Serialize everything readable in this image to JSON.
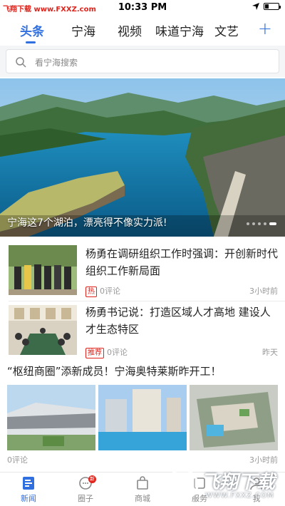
{
  "status_bar": {
    "left_text": "飞翔下载 www.FXXZ.com",
    "time": "10:33 PM"
  },
  "tabs": [
    "头条",
    "宁海",
    "视频",
    "味道宁海",
    "文艺"
  ],
  "add_label": "+",
  "search": {
    "placeholder": "看宁海搜索"
  },
  "banner": {
    "caption": "宁海这7个湖泊，漂亮得不像实力派!"
  },
  "news": [
    {
      "title": "杨勇在调研组织工作时强调：开创新时代组织工作新局面",
      "tag": "热",
      "comments": "0评论",
      "time": "3小时前"
    },
    {
      "title": "杨勇书记说：打造区域人才高地 建设人才生态特区",
      "tag": "推荐",
      "comments": "0评论",
      "time": "昨天"
    },
    {
      "title": "“枢纽商圈”添新成员！宁海奥特莱斯昨开工！",
      "comments": "0评论",
      "time": "3小时前"
    }
  ],
  "bottom_nav": [
    {
      "label": "新闻"
    },
    {
      "label": "圈子",
      "badge": "新"
    },
    {
      "label": "商城"
    },
    {
      "label": "服务"
    },
    {
      "label": "我"
    }
  ],
  "watermark": {
    "text": "飞翔下载",
    "url": "WWW.FXXZ.COM"
  },
  "colors": {
    "accent": "#2f6fe0",
    "hot": "#e0231b"
  }
}
